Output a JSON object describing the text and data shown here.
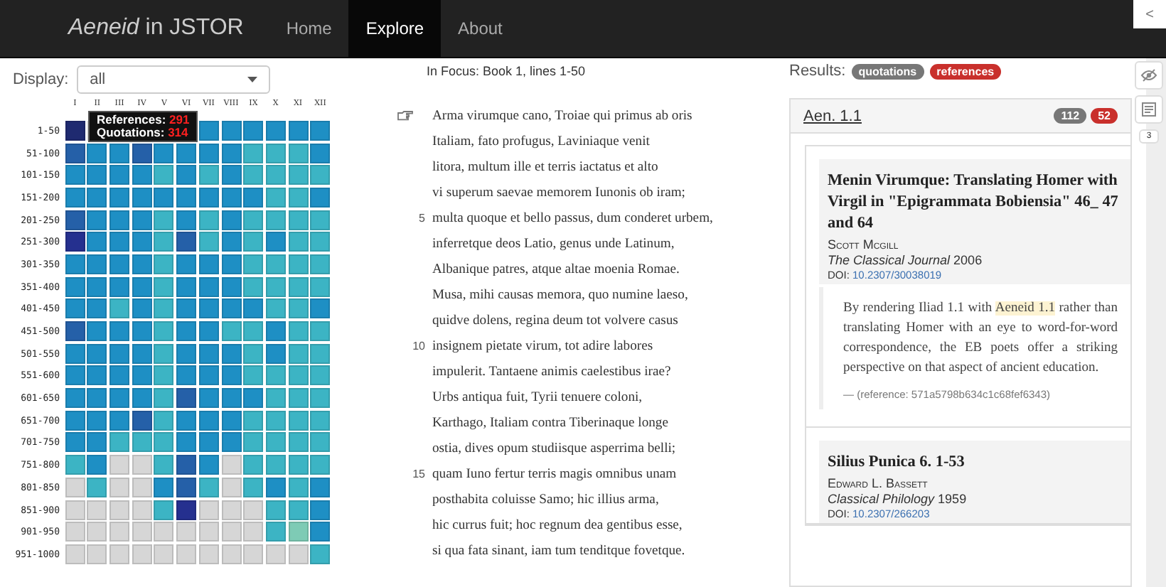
{
  "navbar": {
    "brand_italic": "Aeneid",
    "brand_rest": "in JSTOR",
    "items": [
      {
        "label": "Home",
        "selected": false
      },
      {
        "label": "Explore",
        "selected": true
      },
      {
        "label": "About",
        "selected": false
      }
    ],
    "collapse": "<"
  },
  "display": {
    "label": "Display:",
    "value": "all"
  },
  "heatmap": {
    "columns": [
      "I",
      "II",
      "III",
      "IV",
      "V",
      "VI",
      "VII",
      "VIII",
      "IX",
      "X",
      "XI",
      "XII"
    ],
    "rows": [
      {
        "label": "1-50",
        "cells": [
          {
            "color": "#1f2a70"
          },
          {},
          {},
          {},
          {},
          {},
          {
            "color": "#1e8fc4"
          },
          {
            "color": "#1e8fc4"
          },
          {
            "color": "#1e8fc4"
          },
          {
            "color": "#1e8fc4"
          },
          {
            "color": "#1e8fc4"
          },
          {
            "color": "#1e8fc4"
          }
        ]
      },
      {
        "label": "51-100",
        "cells": [
          {
            "color": "#2560a8"
          },
          {
            "color": "#1e8fc4"
          },
          {
            "color": "#1e8fc4"
          },
          {
            "color": "#2560a8"
          },
          {
            "color": "#1e8fc4"
          },
          {
            "color": "#1e8fc4"
          },
          {
            "color": "#1e8fc4"
          },
          {
            "color": "#1e8fc4"
          },
          {
            "color": "#3cb4c4"
          },
          {
            "color": "#3cb4c4"
          },
          {
            "color": "#3cb4c4"
          },
          {
            "color": "#1e8fc4"
          }
        ]
      },
      {
        "label": "101-150",
        "cells": [
          {
            "color": "#1e8fc4"
          },
          {
            "color": "#1e8fc4"
          },
          {
            "color": "#1e8fc4"
          },
          {
            "color": "#1e8fc4"
          },
          {
            "color": "#3cb4c4"
          },
          {
            "color": "#1e8fc4"
          },
          {
            "color": "#3cb4c4"
          },
          {
            "color": "#1e8fc4"
          },
          {
            "color": "#3cb4c4"
          },
          {
            "color": "#3cb4c4"
          },
          {
            "color": "#3cb4c4"
          },
          {
            "color": "#3cb4c4"
          }
        ]
      },
      {
        "label": "151-200",
        "cells": [
          {
            "color": "#1e8fc4"
          },
          {
            "color": "#1e8fc4"
          },
          {
            "color": "#1e8fc4"
          },
          {
            "color": "#1e8fc4"
          },
          {
            "color": "#1e8fc4"
          },
          {
            "color": "#1e8fc4"
          },
          {
            "color": "#1e8fc4"
          },
          {
            "color": "#1e8fc4"
          },
          {
            "color": "#1e8fc4"
          },
          {
            "color": "#3cb4c4"
          },
          {
            "color": "#3cb4c4"
          },
          {
            "color": "#1e8fc4"
          }
        ]
      },
      {
        "label": "201-250",
        "cells": [
          {
            "color": "#2560a8"
          },
          {
            "color": "#1e8fc4"
          },
          {
            "color": "#1e8fc4"
          },
          {
            "color": "#1e8fc4"
          },
          {
            "color": "#3cb4c4"
          },
          {
            "color": "#1e8fc4"
          },
          {
            "color": "#3cb4c4"
          },
          {
            "color": "#1e8fc4"
          },
          {
            "color": "#3cb4c4"
          },
          {
            "color": "#3cb4c4"
          },
          {
            "color": "#3cb4c4"
          },
          {
            "color": "#3cb4c4"
          }
        ]
      },
      {
        "label": "251-300",
        "cells": [
          {
            "color": "#25308f"
          },
          {
            "color": "#1e8fc4"
          },
          {
            "color": "#1e8fc4"
          },
          {
            "color": "#1e8fc4"
          },
          {
            "color": "#3cb4c4"
          },
          {
            "color": "#2560a8"
          },
          {
            "color": "#3cb4c4"
          },
          {
            "color": "#1e8fc4"
          },
          {
            "color": "#3cb4c4"
          },
          {
            "color": "#1e8fc4"
          },
          {
            "color": "#3cb4c4"
          },
          {
            "color": "#3cb4c4"
          }
        ]
      },
      {
        "label": "301-350",
        "cells": [
          {
            "color": "#1e8fc4"
          },
          {
            "color": "#1e8fc4"
          },
          {
            "color": "#1e8fc4"
          },
          {
            "color": "#1e8fc4"
          },
          {
            "color": "#3cb4c4"
          },
          {
            "color": "#1e8fc4"
          },
          {
            "color": "#1e8fc4"
          },
          {
            "color": "#1e8fc4"
          },
          {
            "color": "#3cb4c4"
          },
          {
            "color": "#3cb4c4"
          },
          {
            "color": "#3cb4c4"
          },
          {
            "color": "#3cb4c4"
          }
        ]
      },
      {
        "label": "351-400",
        "cells": [
          {
            "color": "#1e8fc4"
          },
          {
            "color": "#1e8fc4"
          },
          {
            "color": "#1e8fc4"
          },
          {
            "color": "#1e8fc4"
          },
          {
            "color": "#3cb4c4"
          },
          {
            "color": "#1e8fc4"
          },
          {
            "color": "#1e8fc4"
          },
          {
            "color": "#1e8fc4"
          },
          {
            "color": "#3cb4c4"
          },
          {
            "color": "#3cb4c4"
          },
          {
            "color": "#3cb4c4"
          },
          {
            "color": "#3cb4c4"
          }
        ]
      },
      {
        "label": "401-450",
        "cells": [
          {
            "color": "#1e8fc4"
          },
          {
            "color": "#1e8fc4"
          },
          {
            "color": "#3cb4c4"
          },
          {
            "color": "#1e8fc4"
          },
          {
            "color": "#3cb4c4"
          },
          {
            "color": "#1e8fc4"
          },
          {
            "color": "#1e8fc4"
          },
          {
            "color": "#1e8fc4"
          },
          {
            "color": "#1e8fc4"
          },
          {
            "color": "#3cb4c4"
          },
          {
            "color": "#3cb4c4"
          },
          {
            "color": "#1e8fc4"
          }
        ]
      },
      {
        "label": "451-500",
        "cells": [
          {
            "color": "#2560a8"
          },
          {
            "color": "#1e8fc4"
          },
          {
            "color": "#1e8fc4"
          },
          {
            "color": "#1e8fc4"
          },
          {
            "color": "#3cb4c4"
          },
          {
            "color": "#1e8fc4"
          },
          {
            "color": "#1e8fc4"
          },
          {
            "color": "#3cb4c4"
          },
          {
            "color": "#3cb4c4"
          },
          {
            "color": "#1e8fc4"
          },
          {
            "color": "#3cb4c4"
          },
          {
            "color": "#3cb4c4"
          }
        ]
      },
      {
        "label": "501-550",
        "cells": [
          {
            "color": "#1e8fc4"
          },
          {
            "color": "#1e8fc4"
          },
          {
            "color": "#1e8fc4"
          },
          {
            "color": "#1e8fc4"
          },
          {
            "color": "#3cb4c4"
          },
          {
            "color": "#1e8fc4"
          },
          {
            "color": "#1e8fc4"
          },
          {
            "color": "#1e8fc4"
          },
          {
            "color": "#3cb4c4"
          },
          {
            "color": "#1e8fc4"
          },
          {
            "color": "#3cb4c4"
          },
          {
            "color": "#3cb4c4"
          }
        ]
      },
      {
        "label": "551-600",
        "cells": [
          {
            "color": "#1e8fc4"
          },
          {
            "color": "#1e8fc4"
          },
          {
            "color": "#1e8fc4"
          },
          {
            "color": "#1e8fc4"
          },
          {
            "color": "#3cb4c4"
          },
          {
            "color": "#1e8fc4"
          },
          {
            "color": "#1e8fc4"
          },
          {
            "color": "#1e8fc4"
          },
          {
            "color": "#3cb4c4"
          },
          {
            "color": "#3cb4c4"
          },
          {
            "color": "#3cb4c4"
          },
          {
            "color": "#3cb4c4"
          }
        ]
      },
      {
        "label": "601-650",
        "cells": [
          {
            "color": "#1e8fc4"
          },
          {
            "color": "#1e8fc4"
          },
          {
            "color": "#1e8fc4"
          },
          {
            "color": "#1e8fc4"
          },
          {
            "color": "#3cb4c4"
          },
          {
            "color": "#2560a8"
          },
          {
            "color": "#1e8fc4"
          },
          {
            "color": "#1e8fc4"
          },
          {
            "color": "#1e8fc4"
          },
          {
            "color": "#3cb4c4"
          },
          {
            "color": "#3cb4c4"
          },
          {
            "color": "#3cb4c4"
          }
        ]
      },
      {
        "label": "651-700",
        "cells": [
          {
            "color": "#1e8fc4"
          },
          {
            "color": "#1e8fc4"
          },
          {
            "color": "#1e8fc4"
          },
          {
            "color": "#2560a8"
          },
          {
            "color": "#3cb4c4"
          },
          {
            "color": "#1e8fc4"
          },
          {
            "color": "#1e8fc4"
          },
          {
            "color": "#1e8fc4"
          },
          {
            "color": "#3cb4c4"
          },
          {
            "color": "#3cb4c4"
          },
          {
            "color": "#3cb4c4"
          },
          {
            "color": "#3cb4c4"
          }
        ]
      },
      {
        "label": "701-750",
        "cells": [
          {
            "color": "#1e8fc4"
          },
          {
            "color": "#1e8fc4"
          },
          {
            "color": "#3cb4c4"
          },
          {
            "color": "#3cb4c4"
          },
          {
            "color": "#3cb4c4"
          },
          {
            "color": "#1e8fc4"
          },
          {
            "color": "#1e8fc4"
          },
          {
            "color": "#1e8fc4"
          },
          {
            "color": "#3cb4c4"
          },
          {
            "color": "#3cb4c4"
          },
          {
            "color": "#3cb4c4"
          },
          {
            "color": "#3cb4c4"
          }
        ]
      },
      {
        "label": "751-800",
        "cells": [
          {
            "color": "#3cb4c4"
          },
          {
            "color": "#1e8fc4"
          },
          {
            "color": "#d6d6d6"
          },
          {
            "color": "#d6d6d6"
          },
          {
            "color": "#3cb4c4"
          },
          {
            "color": "#2560a8"
          },
          {
            "color": "#1e8fc4"
          },
          {
            "color": "#d6d6d6"
          },
          {
            "color": "#3cb4c4"
          },
          {
            "color": "#3cb4c4"
          },
          {
            "color": "#3cb4c4"
          },
          {
            "color": "#3cb4c4"
          }
        ]
      },
      {
        "label": "801-850",
        "cells": [
          {
            "color": "#d6d6d6"
          },
          {
            "color": "#3cb4c4"
          },
          {
            "color": "#d6d6d6"
          },
          {
            "color": "#d6d6d6"
          },
          {
            "color": "#1e8fc4"
          },
          {
            "color": "#2560a8"
          },
          {
            "color": "#3cb4c4"
          },
          {
            "color": "#d6d6d6"
          },
          {
            "color": "#3cb4c4"
          },
          {
            "color": "#1e8fc4"
          },
          {
            "color": "#3cb4c4"
          },
          {
            "color": "#1e8fc4"
          }
        ]
      },
      {
        "label": "851-900",
        "cells": [
          {
            "color": "#d6d6d6"
          },
          {
            "color": "#d6d6d6"
          },
          {
            "color": "#d6d6d6"
          },
          {
            "color": "#d6d6d6"
          },
          {
            "color": "#3cb4c4"
          },
          {
            "color": "#25308f"
          },
          {
            "color": "#d6d6d6"
          },
          {
            "color": "#d6d6d6"
          },
          {
            "color": "#d6d6d6"
          },
          {
            "color": "#3cb4c4"
          },
          {
            "color": "#3cb4c4"
          },
          {
            "color": "#1e8fc4"
          }
        ]
      },
      {
        "label": "901-950",
        "cells": [
          {
            "color": "#d6d6d6"
          },
          {
            "color": "#d6d6d6"
          },
          {
            "color": "#d6d6d6"
          },
          {
            "color": "#d6d6d6"
          },
          {
            "color": "#d6d6d6"
          },
          {
            "color": "#d6d6d6"
          },
          {
            "color": "#d6d6d6"
          },
          {
            "color": "#d6d6d6"
          },
          {
            "color": "#d6d6d6"
          },
          {
            "color": "#3cb4c4"
          },
          {
            "color": "#7ecbb5"
          },
          {
            "color": "#1e8fc4"
          }
        ]
      },
      {
        "label": "951-1000",
        "cells": [
          {
            "color": "#d6d6d6"
          },
          {
            "color": "#d6d6d6"
          },
          {
            "color": "#d6d6d6"
          },
          {
            "color": "#d6d6d6"
          },
          {
            "color": "#d6d6d6"
          },
          {
            "color": "#d6d6d6"
          },
          {
            "color": "#d6d6d6"
          },
          {
            "color": "#d6d6d6"
          },
          {
            "color": "#d6d6d6"
          },
          {
            "color": "#d6d6d6"
          },
          {
            "color": "#d6d6d6"
          },
          {
            "color": "#3cb4c4"
          }
        ]
      }
    ],
    "tooltip": {
      "references_label": "References:",
      "references": "291",
      "quotations_label": "Quotations:",
      "quotations": "314"
    }
  },
  "focus": {
    "title": "In Focus: Book 1, lines 1-50",
    "lines": [
      {
        "text": "Arma virumque cano, Troiae qui primus ab oris",
        "pointer": true
      },
      {
        "text": "Italiam, fato profugus, Laviniaque venit"
      },
      {
        "text": "litora, multum ille et terris iactatus et alto"
      },
      {
        "text": "vi superum saevae memorem Iunonis ob iram;"
      },
      {
        "number": "5",
        "text": "multa quoque et bello passus, dum conderet urbem,"
      },
      {
        "text": "inferretque deos Latio, genus unde Latinum,"
      },
      {
        "text": "Albanique patres, atque altae moenia Romae."
      },
      {
        "text": "Musa, mihi causas memora, quo numine laeso,"
      },
      {
        "text": "quidve dolens, regina deum tot volvere casus"
      },
      {
        "number": "10",
        "text": "insignem pietate virum, tot adire labores"
      },
      {
        "text": "impulerit. Tantaene animis caelestibus irae?"
      },
      {
        "text": "Urbs antiqua fuit, Tyrii tenuere coloni,"
      },
      {
        "text": "Karthago, Italiam contra Tiberinaque longe"
      },
      {
        "text": "ostia, dives opum studiisque asperrima belli;"
      },
      {
        "number": "15",
        "text": "quam Iuno fertur terris magis omnibus unam"
      },
      {
        "text": "posthabita coluisse Samo; hic illius arma,"
      },
      {
        "text": "hic currus fuit; hoc regnum dea gentibus esse,"
      },
      {
        "text": "si qua fata sinant, iam tum tenditque fovetque."
      }
    ]
  },
  "results": {
    "label": "Results:",
    "legend": [
      {
        "label": "quotations",
        "color": "#777777"
      },
      {
        "label": "references",
        "color": "#c9302c"
      }
    ],
    "group": {
      "title": "Aen. 1.1",
      "counts": [
        {
          "label": "112",
          "color": "#777777"
        },
        {
          "label": "52",
          "color": "#c9302c"
        }
      ],
      "articles": [
        {
          "title": "Menin Virumque: Translating Homer with Virgil in \"Epigrammata Bobiensia\" 46_ 47 and 64",
          "author": "Scott Mcgill",
          "journal": "The Classical Journal",
          "year": "2006",
          "doi_label": "DOI:",
          "doi": "10.2307/30038019",
          "quote": {
            "before": "By rendering Iliad 1.1 with ",
            "highlight": "Aeneid 1.1",
            "after": " rather than translating Homer with an eye to word-for-word correspondence, the EB poets offer a striking perspective on that aspect of ancient education.",
            "source": "— (reference: 571a5798b634c1c68fef6343)"
          }
        },
        {
          "title": "Silius Punica 6. 1-53",
          "author": "Edward L. Bassett",
          "journal": "Classical Philology",
          "year": "1959",
          "doi_label": "DOI:",
          "doi": "10.2307/266203"
        }
      ]
    }
  },
  "side_tab": "3"
}
